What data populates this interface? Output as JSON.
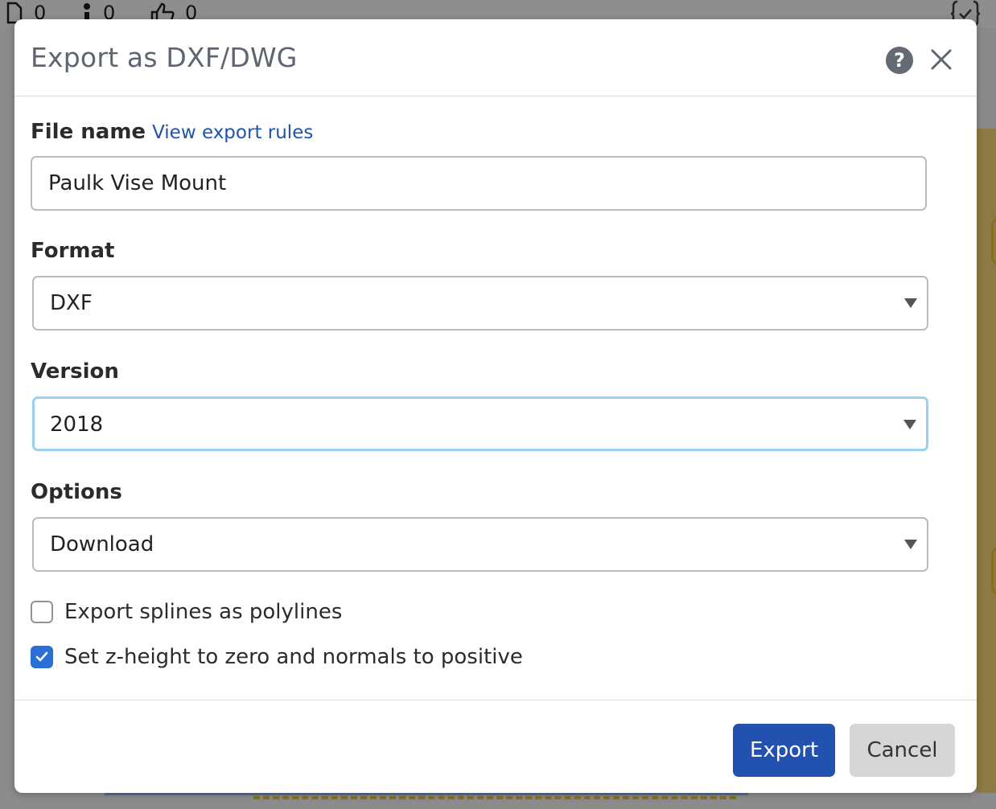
{
  "background": {
    "stats": [
      {
        "icon": "document-icon",
        "value": "0"
      },
      {
        "icon": "info-icon",
        "value": "0"
      },
      {
        "icon": "thumbs-up-icon",
        "value": "0"
      }
    ]
  },
  "dialog": {
    "title": "Export as DXF/DWG",
    "help_icon": "question-circle-icon",
    "close_icon": "close-icon",
    "file_name": {
      "label": "File name",
      "link": "View export rules",
      "value": "Paulk Vise Mount"
    },
    "format": {
      "label": "Format",
      "value": "DXF"
    },
    "version": {
      "label": "Version",
      "value": "2018"
    },
    "options": {
      "label": "Options",
      "value": "Download"
    },
    "checkboxes": [
      {
        "label": "Export splines as polylines",
        "checked": false
      },
      {
        "label": "Set z-height to zero and normals to positive",
        "checked": true
      }
    ],
    "buttons": {
      "export": "Export",
      "cancel": "Cancel"
    }
  },
  "colors": {
    "primary": "#2251b0",
    "link": "#1f54ad",
    "checkbox_checked": "#2a6fd6",
    "focus_border": "#9cd0ef"
  }
}
